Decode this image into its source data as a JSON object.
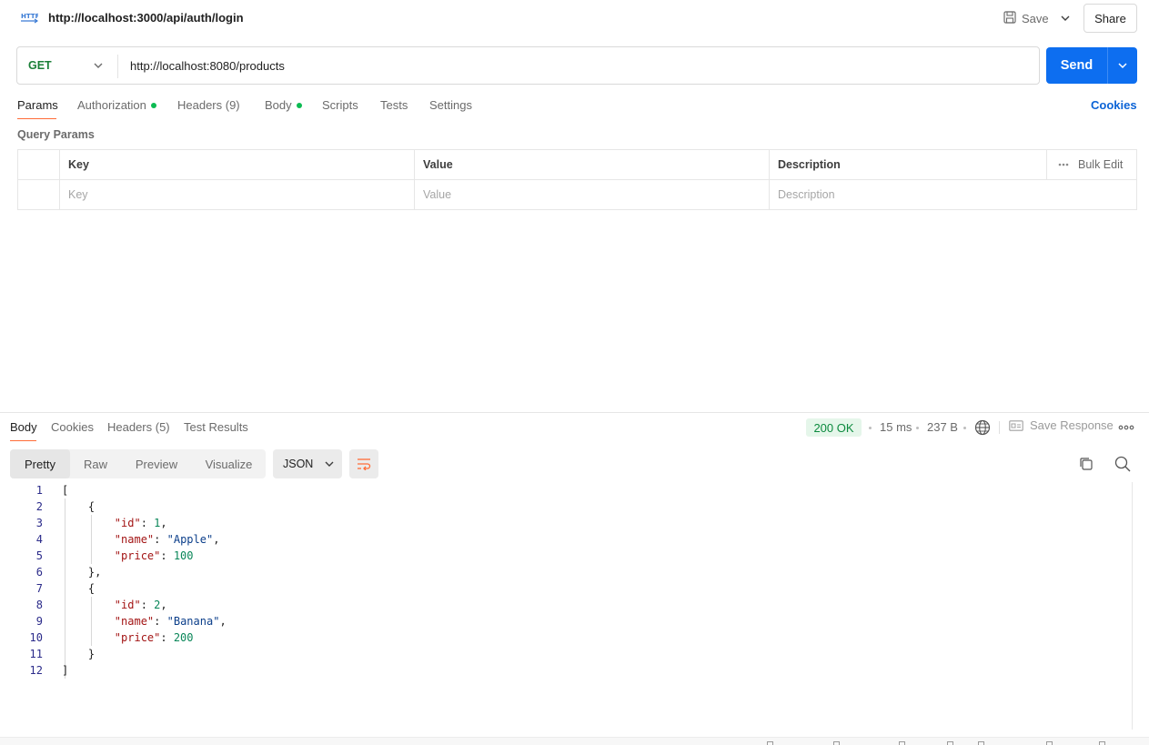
{
  "header": {
    "request_title": "http://localhost:3000/api/auth/login",
    "save_label": "Save",
    "share_label": "Share"
  },
  "request": {
    "method": "GET",
    "url": "http://localhost:8080/products",
    "send_label": "Send"
  },
  "request_tabs": [
    {
      "label": "Params",
      "active": true,
      "dot": false
    },
    {
      "label": "Authorization",
      "active": false,
      "dot": true
    },
    {
      "label": "Headers (9)",
      "active": false,
      "dot": false
    },
    {
      "label": "Body",
      "active": false,
      "dot": true
    },
    {
      "label": "Scripts",
      "active": false,
      "dot": false
    },
    {
      "label": "Tests",
      "active": false,
      "dot": false
    },
    {
      "label": "Settings",
      "active": false,
      "dot": false
    }
  ],
  "cookies_link": "Cookies",
  "query_params": {
    "title": "Query Params",
    "columns": [
      "Key",
      "Value",
      "Description"
    ],
    "bulk_edit_label": "Bulk Edit",
    "placeholders": {
      "key": "Key",
      "value": "Value",
      "description": "Description"
    }
  },
  "response_tabs": [
    {
      "label": "Body",
      "active": true
    },
    {
      "label": "Cookies",
      "active": false
    },
    {
      "label": "Headers (5)",
      "active": false
    },
    {
      "label": "Test Results",
      "active": false
    }
  ],
  "response_meta": {
    "status": "200 OK",
    "time": "15 ms",
    "size": "237 B",
    "save_response_label": "Save Response",
    "status_color": "#0c8a3e"
  },
  "view_modes": [
    {
      "label": "Pretty",
      "active": true
    },
    {
      "label": "Raw",
      "active": false
    },
    {
      "label": "Preview",
      "active": false
    },
    {
      "label": "Visualize",
      "active": false
    }
  ],
  "format": "JSON",
  "code_lines": [
    "1",
    "2",
    "3",
    "4",
    "5",
    "6",
    "7",
    "8",
    "9",
    "10",
    "11",
    "12"
  ],
  "response_body": [
    {
      "id": 1,
      "name": "Apple",
      "price": 100
    },
    {
      "id": 2,
      "name": "Banana",
      "price": 200
    }
  ],
  "colors": {
    "accent": "#ff6c37",
    "send_button": "#0d6ef0",
    "method_get": "#1a7f37",
    "dot_green": "#0cbb52",
    "link_blue": "#0b63d6"
  },
  "icons": {
    "request_type": "http-icon",
    "save": "save-icon",
    "globe": "globe-icon",
    "copy": "copy-icon",
    "search": "search-icon",
    "wrap": "wrap-lines-icon",
    "more": "more-horizontal-icon"
  }
}
